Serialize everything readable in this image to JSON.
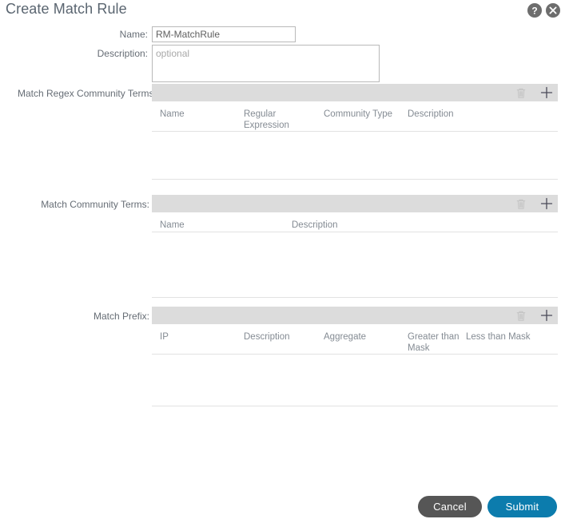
{
  "dialog": {
    "title": "Create Match Rule",
    "help_icon": "help-circle-icon",
    "close_icon": "close-circle-icon"
  },
  "form": {
    "name": {
      "label": "Name:",
      "value": "RM-MatchRule",
      "placeholder": ""
    },
    "description": {
      "label": "Description:",
      "value": "",
      "placeholder": "optional"
    }
  },
  "sections": [
    {
      "label": "Match Regex Community Terms:",
      "delete_icon": "trash-icon",
      "add_icon": "plus-icon",
      "columns": [
        "Name",
        "Regular Expression",
        "Community Type",
        "Description"
      ],
      "rows": []
    },
    {
      "label": "Match Community Terms:",
      "delete_icon": "trash-icon",
      "add_icon": "plus-icon",
      "columns": [
        "Name",
        "Description"
      ],
      "rows": []
    },
    {
      "label": "Match Prefix:",
      "delete_icon": "trash-icon",
      "add_icon": "plus-icon",
      "columns": [
        "IP",
        "Description",
        "Aggregate",
        "Greater than Mask",
        "Less than Mask"
      ],
      "rows": []
    }
  ],
  "footer": {
    "cancel_label": "Cancel",
    "submit_label": "Submit"
  },
  "colors": {
    "toolbar_gray": "#dcdcdc",
    "submit_blue": "#0c7cad",
    "cancel_gray": "#565656",
    "title_gray": "#5a6570",
    "label_gray": "#666d75",
    "column_gray": "#848b93"
  }
}
